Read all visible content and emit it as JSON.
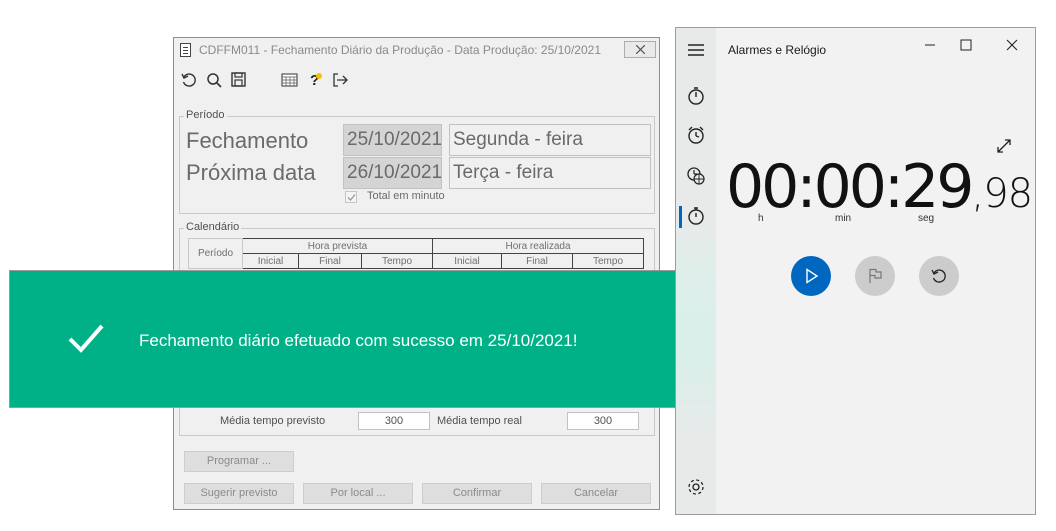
{
  "dialog": {
    "title": "CDFFM011 - Fechamento Diário da Produção - Data Produção: 25/10/2021",
    "toolbar_icons": [
      "refresh-icon",
      "search-icon",
      "save-icon",
      "calendar-icon",
      "help-icon",
      "exit-icon"
    ],
    "periodo": {
      "legend": "Período",
      "fechamento_label": "Fechamento",
      "fechamento_date": "25/10/2021",
      "fechamento_day": "Segunda - feira",
      "proxima_label": "Próxima data",
      "proxima_date": "26/10/2021",
      "proxima_day": "Terça - feira",
      "total_minuto_label": "Total em minuto",
      "total_minuto_checked": true
    },
    "calendario": {
      "legend": "Calendário",
      "periodo_header": "Período",
      "hora_prevista": "Hora prevista",
      "hora_realizada": "Hora realizada",
      "sub_headers": [
        "Inicial",
        "Final",
        "Tempo",
        "Inicial",
        "Final",
        "Tempo"
      ],
      "media_previsto_label": "Média tempo previsto",
      "media_previsto_value": "300",
      "media_real_label": "Média tempo real",
      "media_real_value": "300"
    },
    "buttons": {
      "programar": "Programar ...",
      "sugerir": "Sugerir previsto",
      "por_local": "Por local ...",
      "confirmar": "Confirmar",
      "cancelar": "Cancelar"
    }
  },
  "toast": {
    "message": "Fechamento diário efetuado com sucesso em 25/10/2021!",
    "color": "#00b188"
  },
  "clock_app": {
    "title": "Alarmes e Relógio",
    "nav_icons": [
      "hamburger-menu-icon",
      "timer-icon",
      "alarm-icon",
      "world-clock-icon",
      "stopwatch-icon",
      "settings-icon"
    ],
    "selected_nav": "stopwatch",
    "stopwatch": {
      "time_main": "00:00:29",
      "time_hundredths": ",98",
      "units": {
        "h": "h",
        "min": "min",
        "seg": "seg"
      }
    },
    "accent": "#0067c0"
  }
}
